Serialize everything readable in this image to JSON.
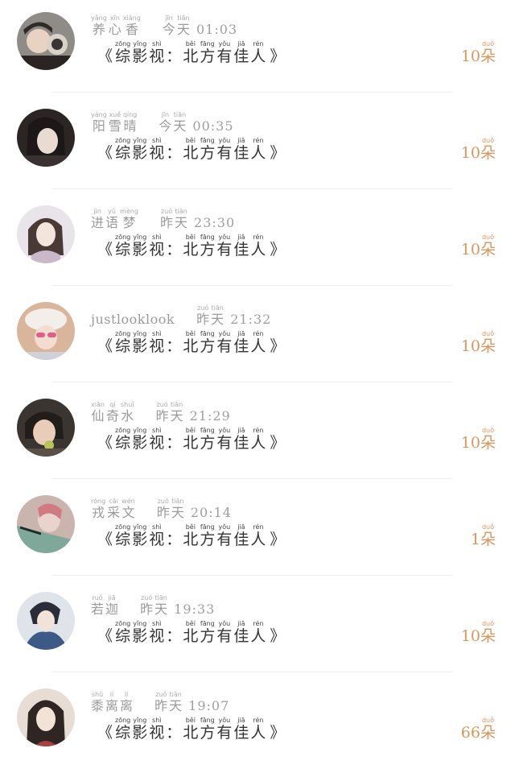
{
  "colors": {
    "accent": "#d8965c",
    "text": "#333333",
    "muted": "#9a9a9a"
  },
  "unit": {
    "py": "duǒ",
    "hz": "朵"
  },
  "message": {
    "open_quote": "《",
    "close_quote": "》",
    "chars": [
      {
        "py": "zōng",
        "hz": "综"
      },
      {
        "py": "yǐng",
        "hz": "影"
      },
      {
        "py": "shì",
        "hz": "视"
      },
      {
        "py": "",
        "hz": "："
      },
      {
        "py": "běi",
        "hz": "北"
      },
      {
        "py": "fāng",
        "hz": "方"
      },
      {
        "py": "yǒu",
        "hz": "有"
      },
      {
        "py": "jiā",
        "hz": "佳"
      },
      {
        "py": "rén",
        "hz": "人"
      }
    ]
  },
  "rows": [
    {
      "name": [
        {
          "py": "yǎng",
          "hz": "养"
        },
        {
          "py": "xīn",
          "hz": "心"
        },
        {
          "py": "xiāng",
          "hz": "香"
        }
      ],
      "day": [
        {
          "py": "jīn",
          "hz": "今"
        },
        {
          "py": "tiān",
          "hz": "天"
        }
      ],
      "time": "01:03",
      "count": "10"
    },
    {
      "name": [
        {
          "py": "yáng",
          "hz": "阳"
        },
        {
          "py": "xuě",
          "hz": "雪"
        },
        {
          "py": "qíng",
          "hz": "晴"
        }
      ],
      "day": [
        {
          "py": "jīn",
          "hz": "今"
        },
        {
          "py": "tiān",
          "hz": "天"
        }
      ],
      "time": "00:35",
      "count": "10"
    },
    {
      "name": [
        {
          "py": "jìn",
          "hz": "进"
        },
        {
          "py": "yǔ",
          "hz": "语"
        },
        {
          "py": "mèng",
          "hz": "梦"
        }
      ],
      "day": [
        {
          "py": "zuó",
          "hz": "昨"
        },
        {
          "py": "tiān",
          "hz": "天"
        }
      ],
      "time": "23:30",
      "count": "10"
    },
    {
      "name": [
        {
          "py": "",
          "hz": "justlooklook"
        }
      ],
      "day": [
        {
          "py": "zuó",
          "hz": "昨"
        },
        {
          "py": "tiān",
          "hz": "天"
        }
      ],
      "time": "21:32",
      "count": "10"
    },
    {
      "name": [
        {
          "py": "xiān",
          "hz": "仙"
        },
        {
          "py": "qí",
          "hz": "奇"
        },
        {
          "py": "shuǐ",
          "hz": "水"
        }
      ],
      "day": [
        {
          "py": "zuó",
          "hz": "昨"
        },
        {
          "py": "tiān",
          "hz": "天"
        }
      ],
      "time": "21:29",
      "count": "10"
    },
    {
      "name": [
        {
          "py": "róng",
          "hz": "戎"
        },
        {
          "py": "cǎi",
          "hz": "采"
        },
        {
          "py": "wén",
          "hz": "文"
        }
      ],
      "day": [
        {
          "py": "zuó",
          "hz": "昨"
        },
        {
          "py": "tiān",
          "hz": "天"
        }
      ],
      "time": "20:14",
      "count": "1"
    },
    {
      "name": [
        {
          "py": "ruò",
          "hz": "若"
        },
        {
          "py": "jiā",
          "hz": "迦"
        }
      ],
      "day": [
        {
          "py": "zuó",
          "hz": "昨"
        },
        {
          "py": "tiān",
          "hz": "天"
        }
      ],
      "time": "19:33",
      "count": "10"
    },
    {
      "name": [
        {
          "py": "shǔ",
          "hz": "黍"
        },
        {
          "py": "lí",
          "hz": "离"
        },
        {
          "py": "lí",
          "hz": "离"
        }
      ],
      "day": [
        {
          "py": "zuó",
          "hz": "昨"
        },
        {
          "py": "tiān",
          "hz": "天"
        }
      ],
      "time": "19:07",
      "count": "66"
    }
  ]
}
